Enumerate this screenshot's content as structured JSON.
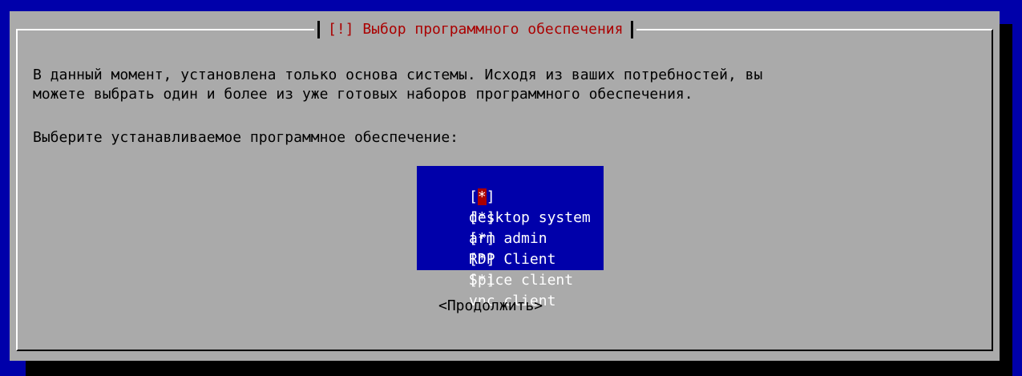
{
  "dialog": {
    "title": "[!] Выбор программного обеспечения",
    "paragraph_line1": "В данный момент, установлена только основа системы. Исходя из ваших потребностей, вы",
    "paragraph_line2": "можете выбрать один и более из уже готовых наборов программного обеспечения.",
    "prompt": "Выберите устанавливаемое программное обеспечение:",
    "items": [
      {
        "checkbox": "[*]",
        "label": "desktop system",
        "checked": true
      },
      {
        "checkbox": "[*]",
        "label": "arm admin",
        "checked": true
      },
      {
        "checkbox": "[*]",
        "label": "RDP Client",
        "checked": true
      },
      {
        "checkbox": "[*]",
        "label": "Spice client",
        "checked": true
      },
      {
        "checkbox": "[*]",
        "label": "vnc client",
        "checked": true
      }
    ],
    "continue_button": "<Продолжить>"
  },
  "colors": {
    "background": "#0000aa",
    "dialog": "#aaaaaa",
    "title": "#aa0000",
    "list_bg": "#0000aa",
    "list_text": "#ffffff",
    "cursor": "#aa0000"
  }
}
